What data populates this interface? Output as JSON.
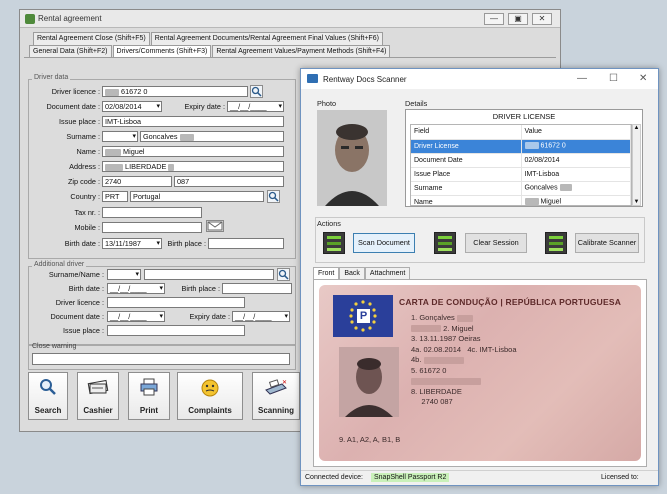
{
  "rental": {
    "title": "Rental agreement",
    "tabs_row1": [
      "Rental Agreement Close (Shift+F5)",
      "Rental Agreement Documents/Rental Agreement Final Values (Shift+F6)"
    ],
    "tabs_row2": [
      "General Data (Shift+F2)",
      "Drivers/Comments (Shift+F3)",
      "Rental Agreement Values/Payment Methods (Shift+F4)"
    ],
    "driver_group": "Driver data",
    "labels": {
      "licence": "Driver licence :",
      "doc_date": "Document date :",
      "expiry": "Expiry date :",
      "issue_place": "Issue place :",
      "surname": "Surname :",
      "name": "Name :",
      "address": "Address :",
      "zip": "Zip code :",
      "country": "Country :",
      "tax": "Tax nr. :",
      "mobile": "Mobile :",
      "birth_date": "Birth date :",
      "birth_place": "Birth place :"
    },
    "values": {
      "licence_suffix": "61672 0",
      "doc_date": "02/08/2014",
      "expiry": "__/__/____",
      "issue_place": "IMT-Lisboa",
      "surname": "Goncalves",
      "name": "Miguel",
      "address": "LIBERDADE",
      "zip": "2740",
      "zip_ext": "087",
      "country_code": "PRT",
      "country_name": "Portugal",
      "birth_date": "13/11/1987"
    },
    "additional_group": "Additional driver",
    "add_labels": {
      "surname_name": "Surname/Name :",
      "birth_date": "Birth date :",
      "birth_place": "Birth place :",
      "licence": "Driver licence :",
      "doc_date": "Document date :",
      "expiry": "Expiry date :",
      "issue_place": "Issue place :"
    },
    "add_values": {
      "birth_date": "__/__/____",
      "doc_date": "__/__/____",
      "expiry": "__/__/____"
    },
    "close_warning": "Close warning",
    "toolbar": [
      "Search",
      "Cashier",
      "Print",
      "Complaints",
      "Scanning"
    ]
  },
  "scanner": {
    "title": "Rentway Docs Scanner",
    "photo_label": "Photo",
    "details_label": "Details",
    "doc_type": "DRIVER LICENSE",
    "col_field": "Field",
    "col_value": "Value",
    "rows": [
      {
        "field": "Driver License",
        "value": "61672 0"
      },
      {
        "field": "Document Date",
        "value": "02/08/2014"
      },
      {
        "field": "Issue Place",
        "value": "IMT-Lisboa"
      },
      {
        "field": "Surname",
        "value": "Goncalves"
      },
      {
        "field": "Name",
        "value": "Miguel"
      }
    ],
    "actions_label": "Actions",
    "buttons": [
      "Scan Document",
      "Clear Session",
      "Calibrate Scanner"
    ],
    "tabs": [
      "Front",
      "Back",
      "Attachment"
    ],
    "card": {
      "header": "CARTA DE CONDUÇÃO | REPÚBLICA PORTUGUESA",
      "eu_letter": "P",
      "l1": "1.  Gonçalves",
      "l2": "2.  Miguel",
      "l3": "3.  13.11.1987 Oeiras",
      "l4a": "4a. 02.08.2014",
      "l4c": "4c. IMT-Lisboa",
      "l4b": "4b.",
      "l5": "5.  61672 0",
      "l8": "8.  LIBERDADE",
      "l8b": "2740 087",
      "l9": "9.  A1, A2, A, B1, B"
    },
    "status_label": "Connected device:",
    "device": "SnapShell Passport R2",
    "licensed": "Licensed to:"
  }
}
